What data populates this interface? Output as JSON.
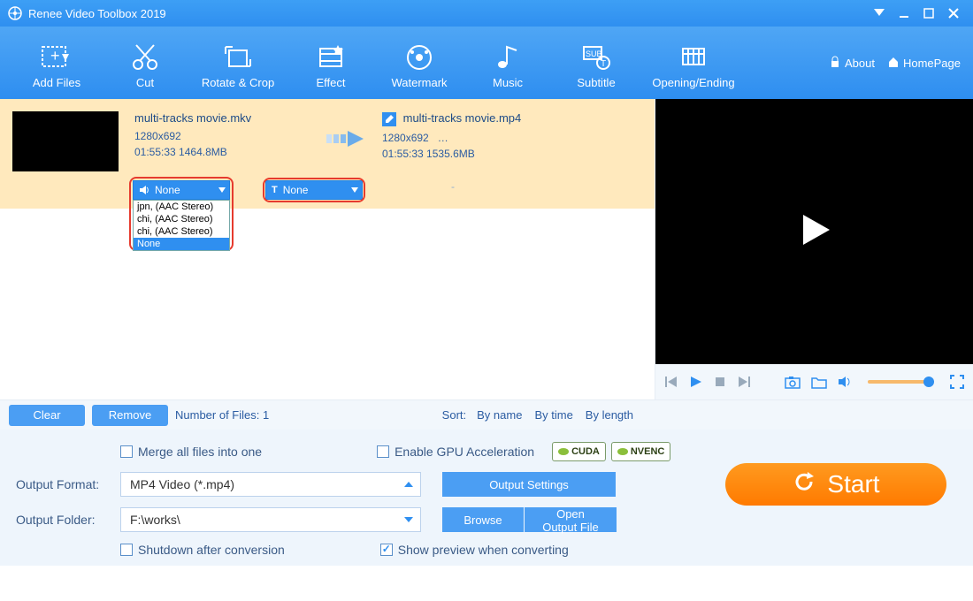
{
  "titlebar": {
    "title": "Renee Video Toolbox 2019"
  },
  "toolbar": {
    "items": [
      {
        "label": "Add Files"
      },
      {
        "label": "Cut"
      },
      {
        "label": "Rotate & Crop"
      },
      {
        "label": "Effect"
      },
      {
        "label": "Watermark"
      },
      {
        "label": "Music"
      },
      {
        "label": "Subtitle"
      },
      {
        "label": "Opening/Ending"
      }
    ],
    "about": "About",
    "homepage": "HomePage"
  },
  "file": {
    "src": {
      "name": "multi-tracks movie.mkv",
      "resolution": "1280x692",
      "stats": "01:55:33 1464.8MB"
    },
    "dst": {
      "name": "multi-tracks movie.mp4",
      "resolution": "1280x692",
      "resolution_extra": "…",
      "stats": "01:55:33 1535.6MB"
    },
    "audio_combo": {
      "selected": "None",
      "options": [
        "jpn,      (AAC Stereo)",
        "chi,      (AAC Stereo)",
        "chi,      (AAC Stereo)",
        "None"
      ],
      "selected_index": 3
    },
    "subtitle_combo": {
      "selected": "None"
    },
    "sub_placeholder": "-"
  },
  "listbar": {
    "clear": "Clear",
    "remove": "Remove",
    "count_label": "Number of Files:  1",
    "sort_label": "Sort:",
    "sort_options": [
      "By name",
      "By time",
      "By length"
    ]
  },
  "bottom": {
    "merge_label": "Merge all files into one",
    "gpu_label": "Enable GPU Acceleration",
    "gpu_badges": [
      "CUDA",
      "NVENC"
    ],
    "format_label": "Output Format:",
    "format_value": "MP4 Video (*.mp4)",
    "output_settings": "Output Settings",
    "folder_label": "Output Folder:",
    "folder_value": "F:\\works\\",
    "browse": "Browse",
    "open_output": "Open Output File",
    "shutdown_label": "Shutdown after conversion",
    "preview_label": "Show preview when converting",
    "start": "Start"
  }
}
